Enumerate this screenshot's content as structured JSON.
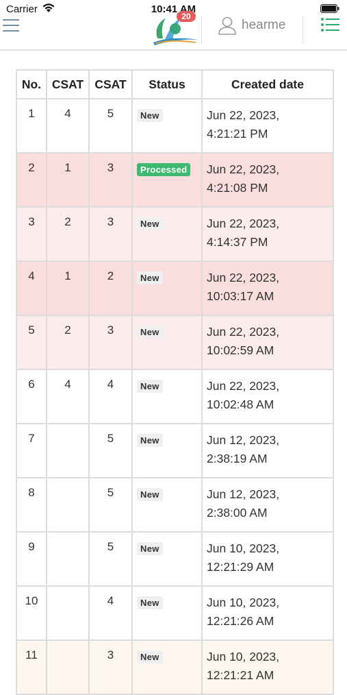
{
  "status_bar": {
    "carrier": "Carrier",
    "time": "10:41 AM"
  },
  "header": {
    "notification_count": "20",
    "username": "hearme",
    "accent_color": "#2aa86a"
  },
  "table": {
    "headers": [
      "No.",
      "CSAT",
      "CSAT",
      "Status",
      "Created date"
    ],
    "rows": [
      {
        "no": "1",
        "csat1": "4",
        "csat2": "5",
        "status": "New",
        "date_line1": "Jun 22, 2023,",
        "date_line2": "4:21:21 PM",
        "tone": "white"
      },
      {
        "no": "2",
        "csat1": "1",
        "csat2": "3",
        "status": "Processed",
        "date_line1": "Jun 22, 2023,",
        "date_line2": "4:21:08 PM",
        "tone": "red"
      },
      {
        "no": "3",
        "csat1": "2",
        "csat2": "3",
        "status": "New",
        "date_line1": "Jun 22, 2023,",
        "date_line2": "4:14:37 PM",
        "tone": "pink"
      },
      {
        "no": "4",
        "csat1": "1",
        "csat2": "2",
        "status": "New",
        "date_line1": "Jun 22, 2023,",
        "date_line2": "10:03:17 AM",
        "tone": "red"
      },
      {
        "no": "5",
        "csat1": "2",
        "csat2": "3",
        "status": "New",
        "date_line1": "Jun 22, 2023,",
        "date_line2": "10:02:59 AM",
        "tone": "pink"
      },
      {
        "no": "6",
        "csat1": "4",
        "csat2": "4",
        "status": "New",
        "date_line1": "Jun 22, 2023,",
        "date_line2": "10:02:48 AM",
        "tone": "white"
      },
      {
        "no": "7",
        "csat1": "",
        "csat2": "5",
        "status": "New",
        "date_line1": "Jun 12, 2023,",
        "date_line2": "2:38:19 AM",
        "tone": "white"
      },
      {
        "no": "8",
        "csat1": "",
        "csat2": "5",
        "status": "New",
        "date_line1": "Jun 12, 2023,",
        "date_line2": "2:38:00 AM",
        "tone": "white"
      },
      {
        "no": "9",
        "csat1": "",
        "csat2": "5",
        "status": "New",
        "date_line1": "Jun 10, 2023,",
        "date_line2": "12:21:29 AM",
        "tone": "white"
      },
      {
        "no": "10",
        "csat1": "",
        "csat2": "4",
        "status": "New",
        "date_line1": "Jun 10, 2023,",
        "date_line2": "12:21:26 AM",
        "tone": "white"
      },
      {
        "no": "11",
        "csat1": "",
        "csat2": "3",
        "status": "New",
        "date_line1": "Jun 10, 2023,",
        "date_line2": "12:21:21 AM",
        "tone": "cream"
      }
    ]
  }
}
